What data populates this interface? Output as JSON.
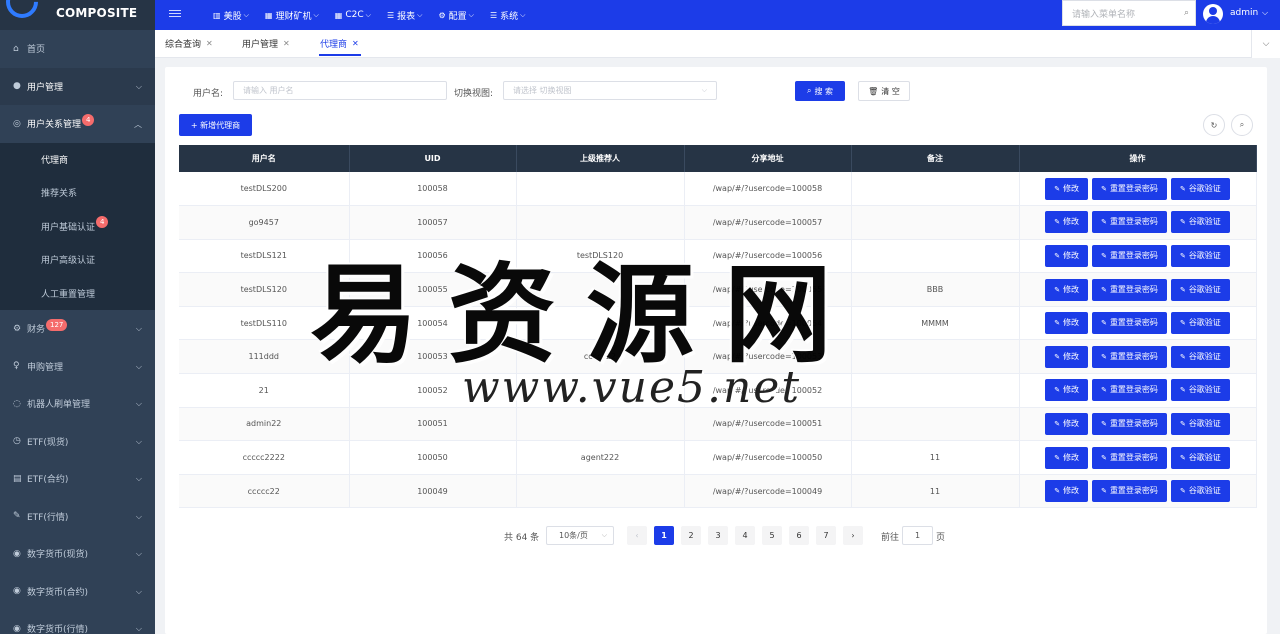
{
  "app": {
    "logo_text": "COMPOSITE"
  },
  "topnav": {
    "items": [
      {
        "label": "美股",
        "icon": "bar-chart-icon"
      },
      {
        "label": "理财矿机",
        "icon": "grid-icon"
      },
      {
        "label": "C2C",
        "icon": "grid-icon"
      },
      {
        "label": "报表",
        "icon": "list-icon"
      },
      {
        "label": "配置",
        "icon": "gear-icon"
      },
      {
        "label": "系统",
        "icon": "list-icon"
      }
    ],
    "search_placeholder": "请输入菜单名称",
    "user": "admin"
  },
  "sidebar": {
    "items": [
      {
        "label": "首页",
        "icon": "home-icon",
        "badge": ""
      },
      {
        "label": "用户管理",
        "icon": "user-icon",
        "badge": ""
      },
      {
        "label": "用户关系管理",
        "icon": "user-circle-icon",
        "badge": "4"
      },
      {
        "label": "财务",
        "icon": "gear-icon",
        "badge": "127"
      },
      {
        "label": "申购管理",
        "icon": "ring-icon",
        "badge": ""
      },
      {
        "label": "机器人刷单管理",
        "icon": "bot-icon",
        "badge": ""
      },
      {
        "label": "ETF(现货)",
        "icon": "clock-icon",
        "badge": ""
      },
      {
        "label": "ETF(合约)",
        "icon": "doc-icon",
        "badge": ""
      },
      {
        "label": "ETF(行情)",
        "icon": "edit-icon",
        "badge": ""
      },
      {
        "label": "数字货币(现货)",
        "icon": "coin-icon",
        "badge": ""
      },
      {
        "label": "数字货币(合约)",
        "icon": "coin-icon",
        "badge": ""
      },
      {
        "label": "数字货币(行情)",
        "icon": "coin-icon",
        "badge": ""
      }
    ],
    "subitems": [
      {
        "label": "代理商",
        "badge": ""
      },
      {
        "label": "推荐关系",
        "badge": ""
      },
      {
        "label": "用户基础认证",
        "badge": "4"
      },
      {
        "label": "用户高级认证",
        "badge": ""
      },
      {
        "label": "人工重置管理",
        "badge": ""
      }
    ]
  },
  "tabs": [
    {
      "label": "综合查询"
    },
    {
      "label": "用户管理"
    },
    {
      "label": "代理商"
    }
  ],
  "filters": {
    "username_label": "用户名:",
    "username_placeholder": "请输入 用户名",
    "view_label": "切换视图:",
    "view_placeholder": "请选择 切换视图",
    "search_btn": "搜 索",
    "clear_btn": "清 空"
  },
  "add_btn": "+ 新增代理商",
  "table": {
    "headers": [
      "用户名",
      "UID",
      "上级推荐人",
      "分享地址",
      "备注",
      "操作"
    ],
    "rows": [
      {
        "username": "testDLS200",
        "uid": "100058",
        "referrer": "",
        "share": "/wap/#/?usercode=100058",
        "remark": ""
      },
      {
        "username": "go9457",
        "uid": "100057",
        "referrer": "",
        "share": "/wap/#/?usercode=100057",
        "remark": ""
      },
      {
        "username": "testDLS121",
        "uid": "100056",
        "referrer": "testDLS120",
        "share": "/wap/#/?usercode=100056",
        "remark": ""
      },
      {
        "username": "testDLS120",
        "uid": "100055",
        "referrer": "",
        "share": "/wap/#/?usercode=100055",
        "remark": "BBB"
      },
      {
        "username": "testDLS110",
        "uid": "100054",
        "referrer": "",
        "share": "/wap/#/?usercode=100054",
        "remark": "MMMM"
      },
      {
        "username": "111ddd",
        "uid": "100053",
        "referrer": "ccccc22",
        "share": "/wap/#/?usercode=100053",
        "remark": ""
      },
      {
        "username": "21",
        "uid": "100052",
        "referrer": "",
        "share": "/wap/#/?usercode=100052",
        "remark": ""
      },
      {
        "username": "admin22",
        "uid": "100051",
        "referrer": "",
        "share": "/wap/#/?usercode=100051",
        "remark": ""
      },
      {
        "username": "ccccc2222",
        "uid": "100050",
        "referrer": "agent222",
        "share": "/wap/#/?usercode=100050",
        "remark": "11"
      },
      {
        "username": "ccccc22",
        "uid": "100049",
        "referrer": "",
        "share": "/wap/#/?usercode=100049",
        "remark": "11"
      }
    ],
    "ops": {
      "edit": "修改",
      "reset": "重置登录密码",
      "google": "谷歌验证"
    }
  },
  "pagination": {
    "total": "共 64 条",
    "page_size": "10条/页",
    "pages": [
      "1",
      "2",
      "3",
      "4",
      "5",
      "6",
      "7"
    ],
    "current": "1",
    "goto_label": "前往",
    "goto_value": "1",
    "page_suffix": "页"
  },
  "watermark": {
    "cn": "易资源网",
    "en": "www.vue5.net"
  }
}
